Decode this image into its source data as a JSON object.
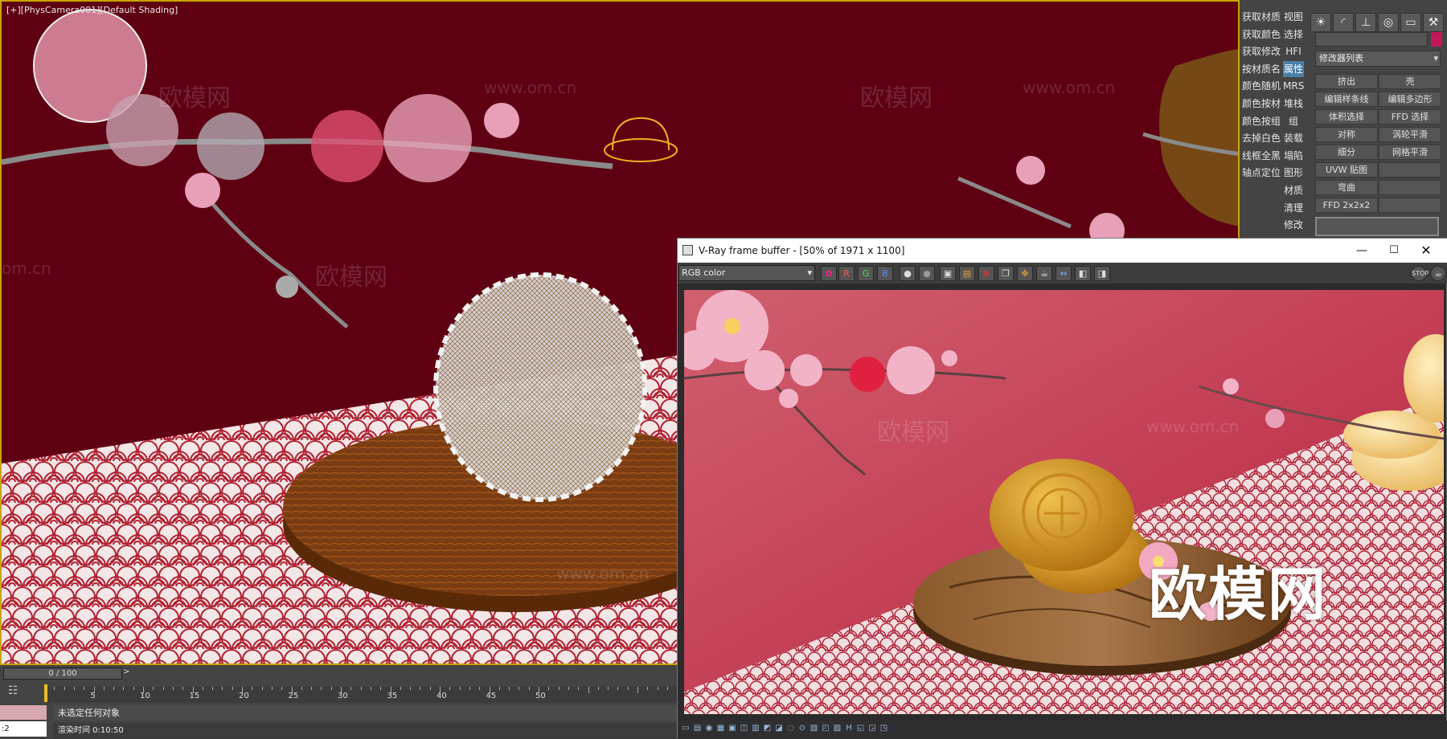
{
  "viewport": {
    "label": "[+][PhysCamera001][Default Shading]",
    "watermarks": [
      "www.om.cn",
      "欧模网",
      "www.om.cn",
      "欧模网",
      "om.cn",
      "欧模网",
      "www.om.cn"
    ]
  },
  "command_panel": {
    "left_column": [
      "获取材质",
      "获取颜色",
      "获取修改",
      "按材质名",
      "颜色随机",
      "颜色按材",
      "颜色按组",
      "去掉白色",
      "线框全黑",
      "轴点定位"
    ],
    "mid_column": [
      "视图",
      "选择",
      "HFI",
      "属性",
      "MRS",
      "堆栈",
      "组",
      "装载",
      "塌陷",
      "图形",
      "材质",
      "清理",
      "修改"
    ],
    "modifier_list": "修改器列表",
    "modifier_buttons": [
      "挤出",
      "壳",
      "编辑样条线",
      "编辑多边形",
      "体积选择",
      "FFD 选择",
      "对称",
      "涡轮平滑",
      "细分",
      "网格平滑",
      "UVW 贴图",
      "",
      "弯曲",
      "",
      "FFD 2x2x2",
      ""
    ],
    "tab_icons": [
      "sun-icon",
      "arc-icon",
      "hierarchy-icon",
      "motion-icon",
      "display-icon",
      "utilities-icon"
    ],
    "accent_color": "#c2185b"
  },
  "timeline": {
    "frame_slider": "0 / 100",
    "ticks": [
      "5",
      "10",
      "15",
      "20",
      "25",
      "30",
      "35",
      "40",
      "45",
      "50"
    ],
    "status_line": "未选定任何对象",
    "render_time": "渲染时间  0:10:50",
    "spinner_value": ":2"
  },
  "vfb": {
    "title": "V-Ray frame buffer - [50% of 1971 x 1100]",
    "channel_select": "RGB color",
    "channel_buttons": [
      "R",
      "G",
      "B"
    ],
    "logo_text": "欧模网",
    "watermarks": [
      "欧模网",
      "www.om.cn"
    ]
  }
}
